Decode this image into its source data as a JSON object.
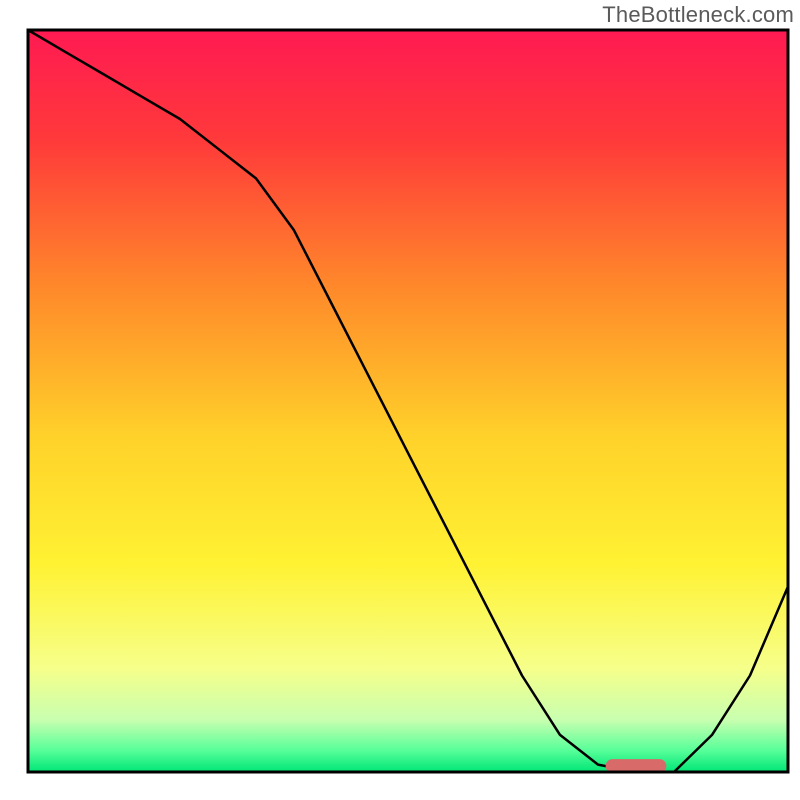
{
  "watermark": "TheBottleneck.com",
  "chart_data": {
    "type": "line",
    "title": "",
    "xlabel": "",
    "ylabel": "",
    "xlim": [
      0,
      100
    ],
    "ylim": [
      0,
      100
    ],
    "x": [
      0,
      5,
      10,
      15,
      20,
      25,
      30,
      35,
      40,
      45,
      50,
      55,
      60,
      65,
      70,
      75,
      80,
      85,
      90,
      95,
      100
    ],
    "values": [
      100,
      97,
      94,
      91,
      88,
      84,
      80,
      73,
      63,
      53,
      43,
      33,
      23,
      13,
      5,
      1,
      0,
      0,
      5,
      13,
      25
    ],
    "marker": {
      "x_start": 76,
      "x_end": 84,
      "y": 0.8
    },
    "background_gradient": {
      "stops": [
        {
          "offset": 0,
          "color": "#ff1a52"
        },
        {
          "offset": 0.15,
          "color": "#ff3a3a"
        },
        {
          "offset": 0.35,
          "color": "#ff8a2a"
        },
        {
          "offset": 0.55,
          "color": "#ffd22a"
        },
        {
          "offset": 0.72,
          "color": "#fff233"
        },
        {
          "offset": 0.86,
          "color": "#f6ff8a"
        },
        {
          "offset": 0.93,
          "color": "#c8ffb0"
        },
        {
          "offset": 0.97,
          "color": "#5aff9a"
        },
        {
          "offset": 1.0,
          "color": "#00e676"
        }
      ]
    },
    "axes": {
      "show_ticks": false,
      "show_grid": false,
      "frame_color": "#000000",
      "frame_width": 3
    }
  }
}
